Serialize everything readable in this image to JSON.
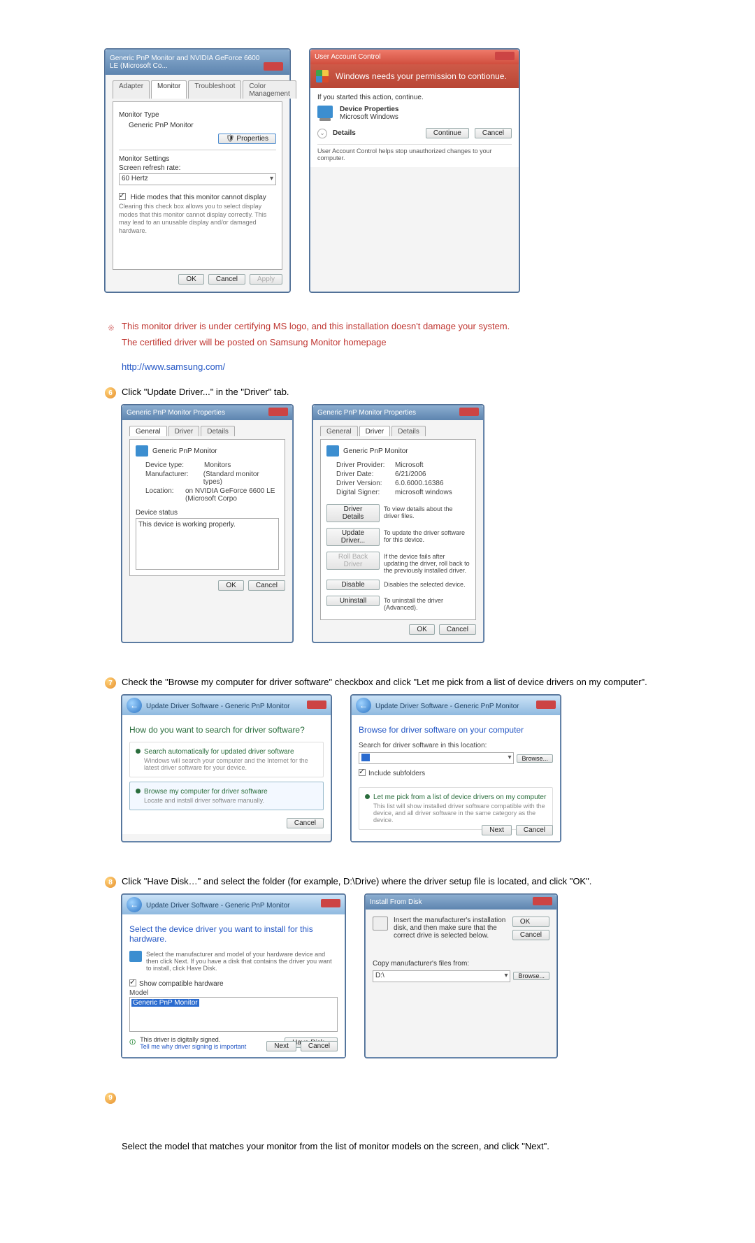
{
  "dialog_monitor_adapter": {
    "title": "Generic PnP Monitor and NVIDIA GeForce 6600 LE (Microsoft Co...",
    "tabs": [
      "Adapter",
      "Monitor",
      "Troubleshoot",
      "Color Management"
    ],
    "active_tab": "Monitor",
    "monitor_type_label": "Monitor Type",
    "monitor_type_value": "Generic PnP Monitor",
    "properties_btn": "Properties",
    "monitor_settings_label": "Monitor Settings",
    "refresh_label": "Screen refresh rate:",
    "refresh_value": "60 Hertz",
    "hide_modes_checkbox": "Hide modes that this monitor cannot display",
    "hide_modes_desc": "Clearing this check box allows you to select display modes that this monitor cannot display correctly. This may lead to an unusable display and/or damaged hardware.",
    "ok": "OK",
    "cancel": "Cancel",
    "apply": "Apply"
  },
  "uac": {
    "title": "User Account Control",
    "headline": "Windows needs your permission to contionue.",
    "if_started": "If you started this action, continue.",
    "app_name": "Device Properties",
    "publisher": "Microsoft Windows",
    "details": "Details",
    "continue": "Continue",
    "cancel": "Cancel",
    "footer": "User Account Control helps stop unauthorized changes to your computer."
  },
  "note_block": {
    "line1": "This monitor driver is under certifying MS logo, and this installation doesn't damage your system.",
    "line2": "The certified driver will be posted on Samsung Monitor homepage",
    "link": "http://www.samsung.com/"
  },
  "step6": {
    "num": "6",
    "text": "Click \"Update Driver...\" in the \"Driver\" tab."
  },
  "prop_general": {
    "title": "Generic PnP Monitor Properties",
    "tabs": [
      "General",
      "Driver",
      "Details"
    ],
    "device_label": "Generic PnP Monitor",
    "rows": {
      "device_type_k": "Device type:",
      "device_type_v": "Monitors",
      "manufacturer_k": "Manufacturer:",
      "manufacturer_v": "(Standard monitor types)",
      "location_k": "Location:",
      "location_v": "on NVIDIA GeForce 6600 LE (Microsoft Corpo"
    },
    "status_label": "Device status",
    "status_text": "This device is working properly.",
    "ok": "OK",
    "cancel": "Cancel"
  },
  "prop_driver": {
    "title": "Generic PnP Monitor Properties",
    "tabs": [
      "General",
      "Driver",
      "Details"
    ],
    "device_label": "Generic PnP Monitor",
    "rows": {
      "provider_k": "Driver Provider:",
      "provider_v": "Microsoft",
      "date_k": "Driver Date:",
      "date_v": "6/21/2006",
      "version_k": "Driver Version:",
      "version_v": "6.0.6000.16386",
      "signer_k": "Digital Signer:",
      "signer_v": "microsoft windows"
    },
    "buttons": {
      "details": "Driver Details",
      "details_d": "To view details about the driver files.",
      "update": "Update Driver...",
      "update_d": "To update the driver software for this device.",
      "rollback": "Roll Back Driver",
      "rollback_d": "If the device fails after updating the driver, roll back to the previously installed driver.",
      "disable": "Disable",
      "disable_d": "Disables the selected device.",
      "uninstall": "Uninstall",
      "uninstall_d": "To uninstall the driver (Advanced)."
    },
    "ok": "OK",
    "cancel": "Cancel"
  },
  "step7": {
    "num": "7",
    "text": "Check the \"Browse my computer for driver software\" checkbox and click \"Let me pick from a list of device drivers on my computer\"."
  },
  "wiz_choose": {
    "crumb": "Update Driver Software - Generic PnP Monitor",
    "heading": "How do you want to search for driver software?",
    "opt1_title": "Search automatically for updated driver software",
    "opt1_sub": "Windows will search your computer and the Internet for the latest driver software for your device.",
    "opt2_title": "Browse my computer for driver software",
    "opt2_sub": "Locate and install driver software manually.",
    "cancel": "Cancel"
  },
  "wiz_browse": {
    "crumb": "Update Driver Software - Generic PnP Monitor",
    "heading": "Browse for driver software on your computer",
    "search_label": "Search for driver software in this location:",
    "path_value": "",
    "browse": "Browse...",
    "include_sub": "Include subfolders",
    "pick_title": "Let me pick from a list of device drivers on my computer",
    "pick_sub": "This list will show installed driver software compatible with the device, and all driver software in the same category as the device.",
    "next": "Next",
    "cancel": "Cancel"
  },
  "step8": {
    "num": "8",
    "text": "Click \"Have Disk…\" and select the folder (for example, D:\\Drive) where the driver setup file is located, and click \"OK\"."
  },
  "wiz_model": {
    "crumb": "Update Driver Software - Generic PnP Monitor",
    "heading": "Select the device driver you want to install for this hardware.",
    "sub": "Select the manufacturer and model of your hardware device and then click Next. If you have a disk that contains the driver you want to install, click Have Disk.",
    "compat_chk": "Show compatible hardware",
    "model_col": "Model",
    "model_item": "Generic PnP Monitor",
    "signed_line": "This driver is digitally signed.",
    "tell_link": "Tell me why driver signing is important",
    "have_disk": "Have Disk...",
    "next": "Next",
    "cancel": "Cancel"
  },
  "install_from_disk": {
    "title": "Install From Disk",
    "desc": "Insert the manufacturer's installation disk, and then make sure that the correct drive is selected below.",
    "ok": "OK",
    "cancel": "Cancel",
    "copy_label": "Copy manufacturer's files from:",
    "path": "D:\\",
    "browse": "Browse..."
  },
  "step9": {
    "num": "9",
    "text": "Select the model that matches your monitor from the list of monitor models on the screen, and click \"Next\"."
  }
}
